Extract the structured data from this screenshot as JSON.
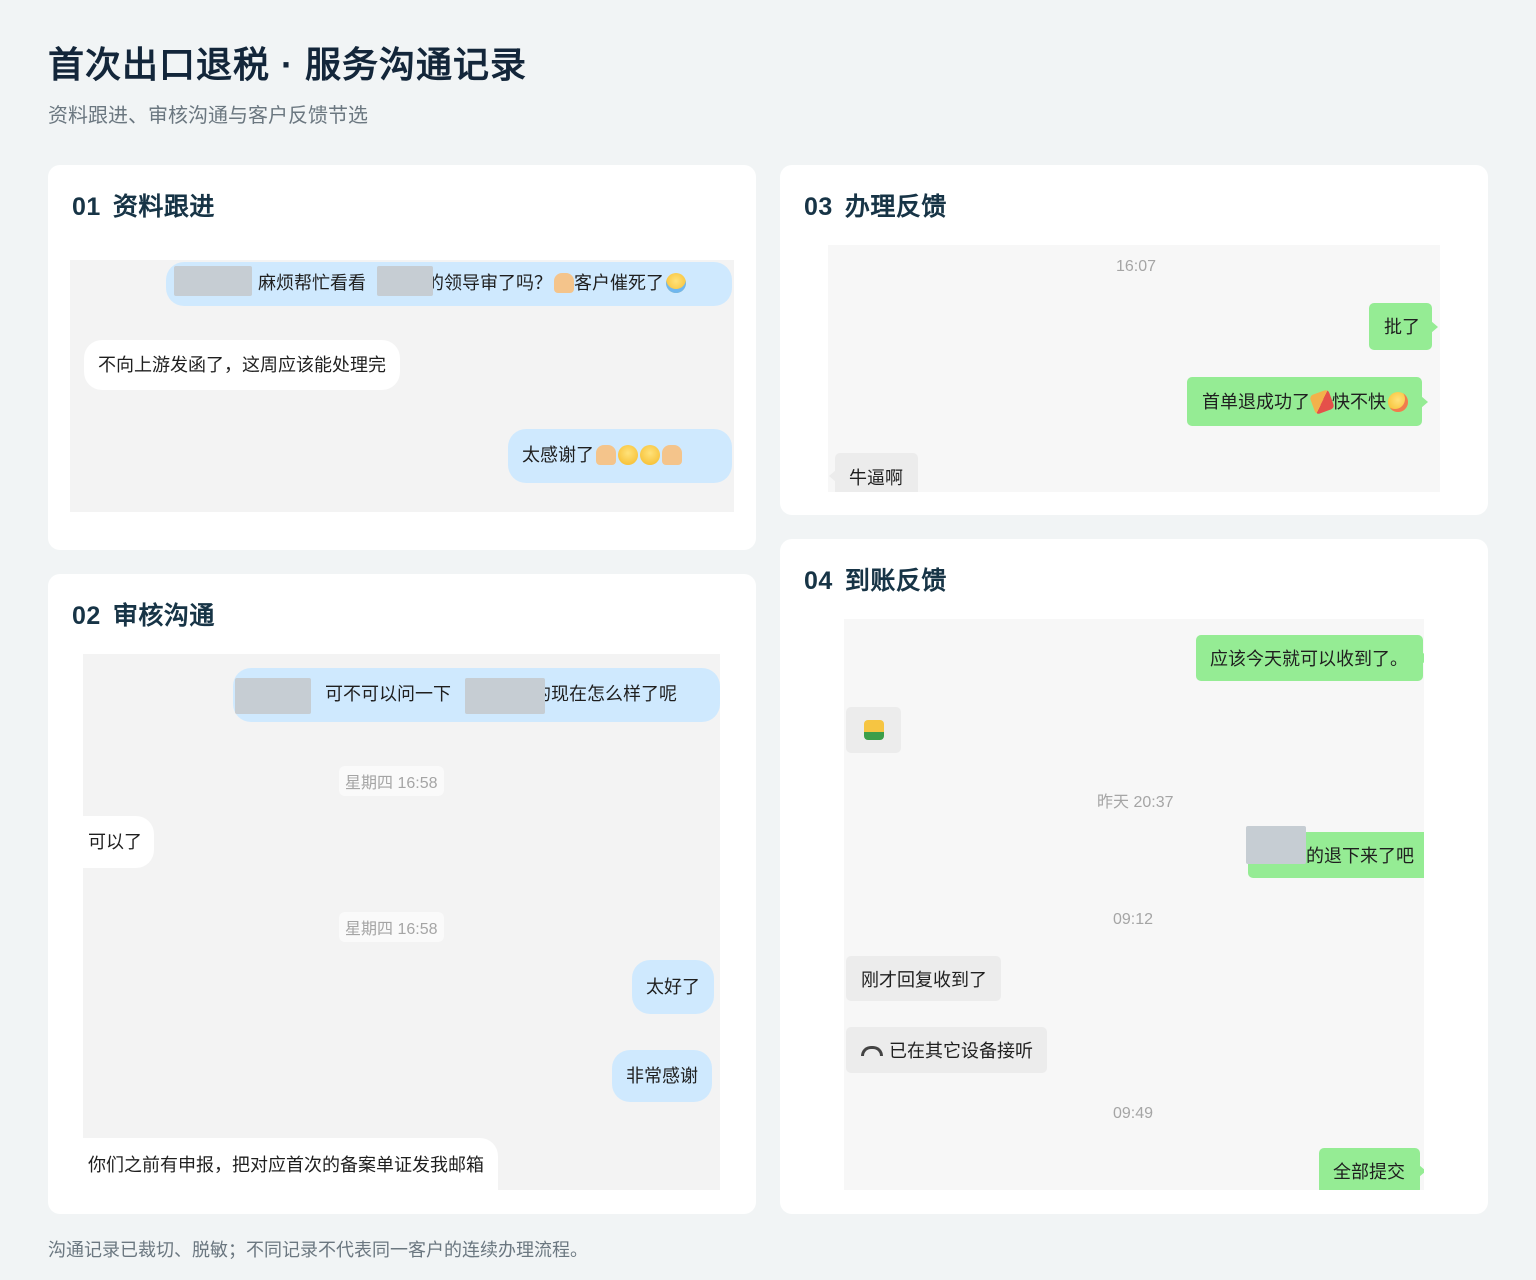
{
  "header": {
    "title": "首次出口退税 · 服务沟通记录",
    "subtitle": "资料跟进、审核沟通与客户反馈节选"
  },
  "footer": {
    "note": "沟通记录已裁切、脱敏；不同记录不代表同一客户的连续办理流程。"
  },
  "colors": {
    "page_bg": "#f1f4f5",
    "card_bg": "#ffffff",
    "bubble_blue": "#cfe9fe",
    "bubble_green": "#95ec94",
    "bubble_gray": "#ececec",
    "redaction": "#c6cdd3"
  },
  "cards": {
    "c1": {
      "num": "01",
      "title": "资料跟进",
      "messages": {
        "m1": {
          "text_a": "麻烦帮忙看看",
          "text_b": "的领导审了吗？",
          "text_c": "客户催死了",
          "emoji": [
            "folded-hands-icon",
            "crying-face-icon"
          ]
        },
        "m2": {
          "text": "不向上游发函了，这周应该能处理完"
        },
        "m3": {
          "text": "太感谢了",
          "emoji": [
            "folded-hands-icon",
            "smiling-face-icon",
            "smiling-face-icon",
            "folded-hands-icon"
          ]
        }
      }
    },
    "c2": {
      "num": "02",
      "title": "审核沟通",
      "messages": {
        "m1": {
          "text_a": "可不可以问一下",
          "text_b": "的现在怎么样了呢"
        },
        "ts1": "星期四 16:58",
        "m2": {
          "text": "可以了"
        },
        "ts2": "星期四 16:58",
        "m3": {
          "text": "太好了"
        },
        "m4": {
          "text": "非常感谢"
        },
        "m5": {
          "text": "你们之前有申报，把对应首次的备案单证发我邮箱"
        }
      }
    },
    "c3": {
      "num": "03",
      "title": "办理反馈",
      "messages": {
        "ts1": "16:07",
        "m1": {
          "text": "批了"
        },
        "m2": {
          "text_a": "首单退成功了",
          "text_b": "快不快",
          "emoji": [
            "party-popper-icon",
            "laughing-face-icon"
          ]
        },
        "m3": {
          "text": "牛逼啊"
        }
      }
    },
    "c4": {
      "num": "04",
      "title": "到账反馈",
      "messages": {
        "m1": {
          "text": "应该今天就可以收到了。"
        },
        "m2": {
          "emoji": "thumbs-up-icon"
        },
        "ts1": "昨天 20:37",
        "m3": {
          "text": "的退下来了吧"
        },
        "ts2": "09:12",
        "m4": {
          "text": "刚才回复收到了"
        },
        "m5": {
          "text": "已在其它设备接听",
          "icon": "phone-hangup-icon"
        },
        "ts3": "09:49",
        "m6": {
          "text": "全部提交"
        }
      }
    }
  }
}
